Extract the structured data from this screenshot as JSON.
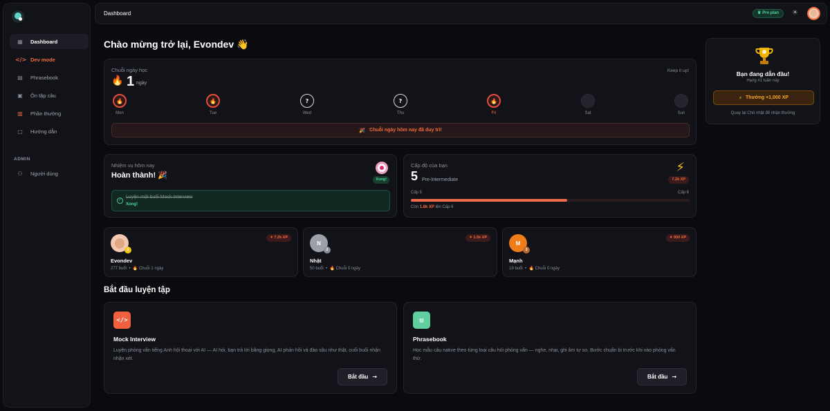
{
  "sidebar": {
    "items": [
      {
        "label": "Dashboard",
        "icon": "grid-icon"
      },
      {
        "label": "Dev mode",
        "icon": "code-icon"
      },
      {
        "label": "Phrasebook",
        "icon": "book-icon"
      },
      {
        "label": "Ôn tập câu",
        "icon": "clipboard-icon"
      },
      {
        "label": "Phần thưởng",
        "icon": "gift-icon"
      },
      {
        "label": "Hướng dẫn",
        "icon": "guide-icon"
      }
    ],
    "admin_label": "ADMIN",
    "admin_items": [
      {
        "label": "Người dùng",
        "icon": "users-icon"
      }
    ]
  },
  "header": {
    "breadcrumb": "Dashboard",
    "plan_badge": "Pro plan"
  },
  "welcome": "Chào mừng trở lại, Evondev 👋",
  "streak": {
    "label": "Chuỗi ngày học",
    "keep": "Keep it up!",
    "count": "1",
    "unit": "ngày",
    "days": [
      {
        "label": "Mon",
        "state": "done",
        "glyph": "🔥"
      },
      {
        "label": "Tue",
        "state": "done",
        "glyph": "🔥"
      },
      {
        "label": "Wed",
        "state": "miss",
        "glyph": "?"
      },
      {
        "label": "Thu",
        "state": "miss",
        "glyph": "?"
      },
      {
        "label": "Fri",
        "state": "today",
        "glyph": "🔥"
      },
      {
        "label": "Sat",
        "state": "future",
        "glyph": ""
      },
      {
        "label": "Sun",
        "state": "future",
        "glyph": ""
      }
    ],
    "banner": "Chuỗi ngày hôm nay đã duy trì!"
  },
  "quest": {
    "label": "Nhiệm vụ hôm nay",
    "title": "Hoàn thành! 🎉",
    "badge": "Xong!",
    "item": "Luyện một buổi Mock Interview",
    "item_status": "Xong!"
  },
  "level": {
    "label": "Cấp độ của bạn",
    "number": "5",
    "name": "Pre-Intermediate",
    "xp": "7.2k XP",
    "from": "Cấp 5",
    "to": "Cấp 6",
    "progress": 0.56,
    "remain_prefix": "Còn",
    "remain_value": "1.8k XP",
    "remain_suffix": "lên Cấp 6"
  },
  "leaderboard": [
    {
      "name": "Evondev",
      "initial": "",
      "rank": "1",
      "xp": "7.2k XP",
      "sessions": "277 buổi",
      "streak": "Chuỗi 1 ngày",
      "color": "#f3c7b1",
      "rank_color": "#f5c518"
    },
    {
      "name": "Nhật",
      "initial": "N",
      "rank": "2",
      "xp": "1.5k XP",
      "sessions": "50 buổi",
      "streak": "Chuỗi 0 ngày",
      "color": "#9ea0a8",
      "rank_color": "#8d8f98"
    },
    {
      "name": "Mạnh",
      "initial": "M",
      "rank": "3",
      "xp": "900 XP",
      "sessions": "19 buổi",
      "streak": "Chuỗi 0 ngày",
      "color": "#f07c1a",
      "rank_color": "#b86a2e"
    }
  ],
  "practice": {
    "title": "Bắt đầu luyện tập",
    "cards": [
      {
        "title": "Mock Interview",
        "desc": "Luyện phỏng vấn tiếng Anh hội thoại với AI — AI hỏi, bạn trả lời bằng giọng, AI phản hồi và đào sâu như thật, cuối buổi nhận nhận xét.",
        "button": "Bắt đầu",
        "color": "#f1603f",
        "icon": "code-icon"
      },
      {
        "title": "Phrasebook",
        "desc": "Học mẫu câu native theo từng loại câu hỏi phỏng vấn — nghe, nhại, ghi âm tự so. Bước chuẩn bị trước khi vào phỏng vấn thử.",
        "button": "Bắt đầu",
        "color": "#5fcfa0",
        "icon": "book-icon"
      }
    ]
  },
  "leader_panel": {
    "title": "Bạn đang dẫn đầu!",
    "sub": "Hạng #1 tuần này",
    "reward": "Thưởng +1,000 XP",
    "foot": "Quay lại Chủ nhật để nhận thưởng"
  }
}
